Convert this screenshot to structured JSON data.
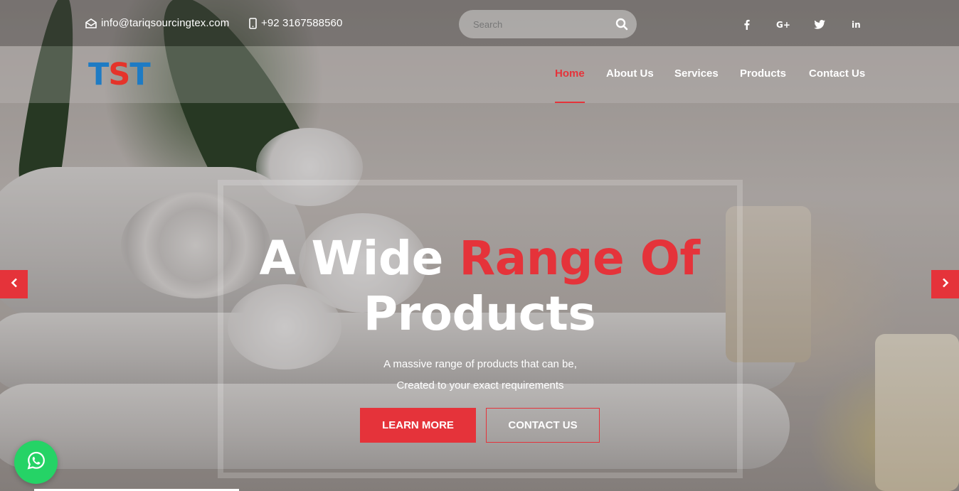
{
  "topbar": {
    "email": "info@tariqsourcingtex.com",
    "phone": "+92 3167588560",
    "search": {
      "placeholder": "Search"
    },
    "socials": [
      {
        "label": "f",
        "icon": "facebook-icon"
      },
      {
        "label": "G+",
        "icon": "google-plus-icon"
      },
      {
        "label": "twitter",
        "icon": "twitter-icon"
      },
      {
        "label": "in",
        "icon": "linkedin-icon"
      }
    ]
  },
  "header": {
    "logo": {
      "part1": "T",
      "part2": "S",
      "part3": "T"
    },
    "nav": [
      {
        "label": "Home",
        "active": true
      },
      {
        "label": "About Us",
        "active": false
      },
      {
        "label": "Services",
        "active": false
      },
      {
        "label": "Products",
        "active": false
      },
      {
        "label": "Contact Us",
        "active": false
      }
    ]
  },
  "hero": {
    "title_part1": "A Wide ",
    "title_accent": "Range Of",
    "title_line2": "Products",
    "subtitle_line1": "A massive range of products that can be,",
    "subtitle_line2": "Created to your exact requirements",
    "learn_more": "LEARN MORE",
    "contact_us": "CONTACT US"
  },
  "colors": {
    "accent": "#e5333a",
    "logo_blue": "#1e7bc4",
    "whatsapp": "#25d366"
  },
  "icons": {
    "prev": "chevron-left-icon",
    "next": "chevron-right-icon",
    "whatsapp": "whatsapp-icon"
  }
}
